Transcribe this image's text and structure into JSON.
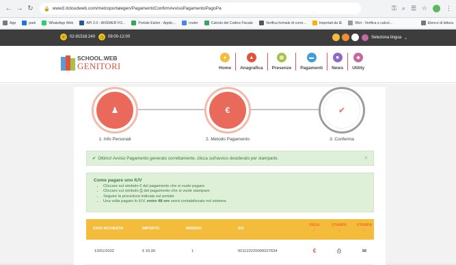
{
  "browser": {
    "url": "www3.itcloudweb.com/melzoportalegen/Pagamenti/ConfirmAvvisoPagamentoPagoPa",
    "bookmarks": [
      {
        "label": "App",
        "color": "#7a7a7a"
      },
      {
        "label": "park",
        "color": "#1a73e8"
      },
      {
        "label": "WhatsApp Web",
        "color": "#25d366"
      },
      {
        "label": "API 2.0 - ANSWER FO...",
        "color": "#2b579a"
      },
      {
        "label": "Portale Esilon - Applic...",
        "color": "#34a853"
      },
      {
        "label": "router",
        "color": "#4285f4"
      },
      {
        "label": "Calcolo del Codice Fiscale",
        "color": "#3ba55c"
      },
      {
        "label": "Verifica formale di corre...",
        "color": "#555555"
      },
      {
        "label": "Importati da IE",
        "color": "#f4b400"
      },
      {
        "label": "Ritrt - Verifica e calcol...",
        "color": "#999999"
      },
      {
        "label": "Elenco di lettura",
        "color": "#777777"
      }
    ]
  },
  "topbar": {
    "phone": "02-91518.240",
    "hours": "09:00-12:00",
    "language": "Seleziona lingua"
  },
  "logo": {
    "line1": "SCHOOL.WEB",
    "line2": "GENITORI"
  },
  "menu": [
    {
      "label": "Home",
      "color": "#f3bc3a",
      "glyph": "●"
    },
    {
      "label": "Anagrafica",
      "color": "#e2533f",
      "glyph": "▲"
    },
    {
      "label": "Presenze",
      "color": "#a6c24b",
      "glyph": "▦"
    },
    {
      "label": "Pagamenti",
      "color": "#3f9dd6",
      "glyph": "▬"
    },
    {
      "label": "News",
      "color": "#8c6bc8",
      "glyph": "■"
    },
    {
      "label": "Utility",
      "color": "#c667a6",
      "glyph": "◆"
    }
  ],
  "steps": [
    {
      "label": "1. Info Personali",
      "glyph": "♟",
      "state": "done"
    },
    {
      "label": "2. Metodo Pagamento",
      "glyph": "€",
      "state": "done"
    },
    {
      "label": "3. Conferma",
      "glyph": "✔",
      "state": "current"
    }
  ],
  "success_message": "Ottimo! Avviso Pagamento generato correttamente, clicca sull'avviso desiderato per stamparlo.",
  "howto": {
    "title": "Come pagare uno IUV",
    "items": [
      "Cliccare sul simbolo € del pagamento che si vuole pagare",
      "Cliccare sul simbolo ⎙ del pagamento che si vuole stampare",
      "Seguire la procedura indicata sul portale"
    ],
    "last_item_pre": "Una volta pagato lo IUV, ",
    "last_item_bold": "entro 48 ore",
    "last_item_post": " verrà contabilizzato nel sistema"
  },
  "table": {
    "headers": {
      "date": "DATA RICHIESTA",
      "amount": "IMPORTO",
      "installments": "RIRIODO",
      "iuv": "IUV",
      "pay": "PAGA",
      "print": "STAMPA",
      "print_send": "STAMPA"
    },
    "rows": [
      {
        "date": "13/01/2022",
        "amount": "€ 10,00",
        "installments": "1",
        "iuv": "001122220000027634"
      }
    ]
  }
}
